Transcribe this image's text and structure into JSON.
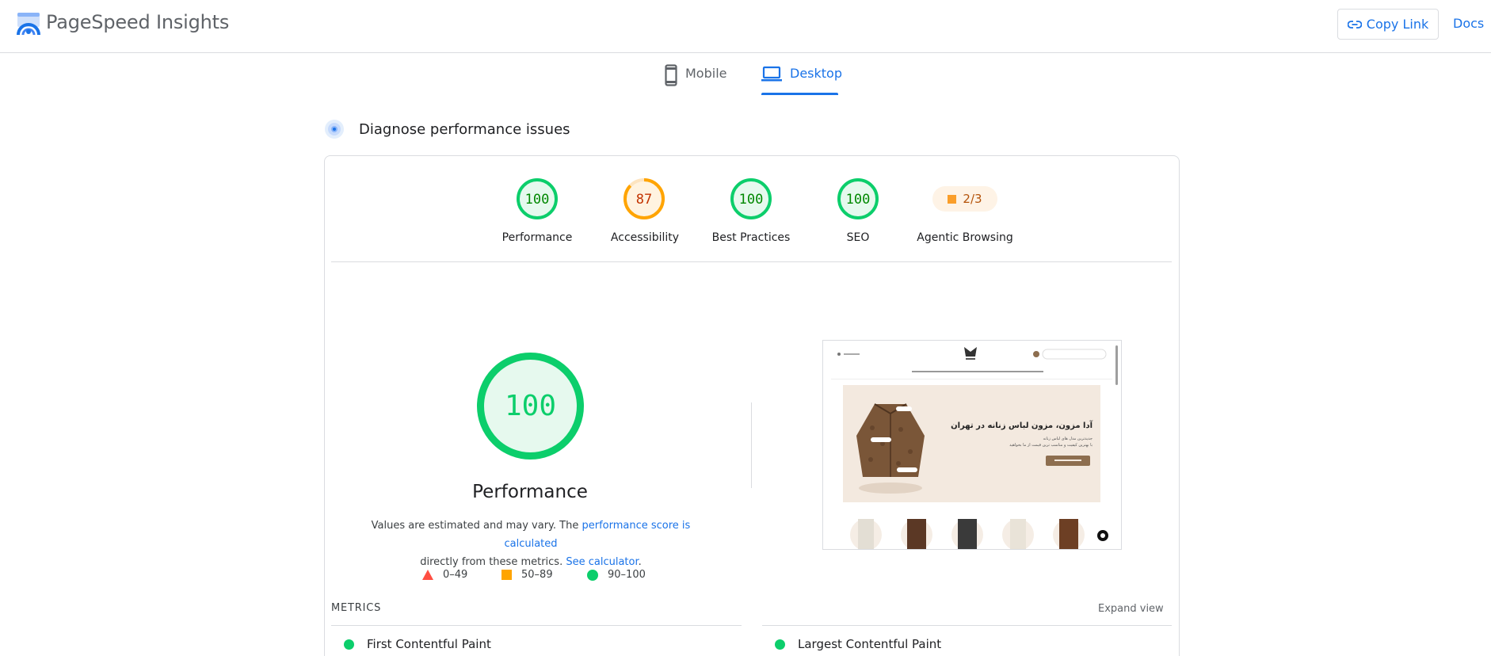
{
  "header": {
    "brand": "PageSpeed Insights",
    "copy_link_label": "Copy Link",
    "docs_label": "Docs",
    "logo_icon": "pagespeed-logo-icon",
    "link_icon": "link-icon"
  },
  "tabs": [
    {
      "label": "Mobile",
      "icon": "mobile-phone-icon",
      "active": false
    },
    {
      "label": "Desktop",
      "icon": "laptop-icon",
      "active": true
    }
  ],
  "diagnose": {
    "title": "Diagnose performance issues",
    "icon": "lighthouse-icon"
  },
  "categories": [
    {
      "label": "Performance",
      "score": "100",
      "status": "pass"
    },
    {
      "label": "Accessibility",
      "score": "87",
      "status": "average"
    },
    {
      "label": "Best Practices",
      "score": "100",
      "status": "pass"
    },
    {
      "label": "SEO",
      "score": "100",
      "status": "pass"
    },
    {
      "label": "Agentic Browsing",
      "score": "2/3",
      "status": "average"
    }
  ],
  "performance": {
    "score": "100",
    "title": "Performance",
    "desc_prefix": "Values are estimated and may vary. The ",
    "desc_link1": "performance score is calculated",
    "desc_middle": "directly from these metrics. ",
    "desc_link2": "See calculator",
    "desc_suffix": "."
  },
  "legend": [
    {
      "range": "0–49",
      "shape": "triangle",
      "color": "#ff4e42"
    },
    {
      "range": "50–89",
      "shape": "square",
      "color": "#ffa400"
    },
    {
      "range": "90–100",
      "shape": "circle",
      "color": "#0cce6b"
    }
  ],
  "metrics": {
    "heading": "METRICS",
    "expand_label": "Expand view",
    "items": [
      {
        "label": "First Contentful Paint",
        "status": "pass"
      },
      {
        "label": "Largest Contentful Paint",
        "status": "pass"
      }
    ]
  },
  "screenshot": {
    "hero_title": "آدا مزون، مزون لباس زنانه در تهران",
    "hero_sub1": "جدیدترین مدل های لباس زنانه",
    "hero_sub2": "با بهترین کیفیت و مناسب ترین قیمت از ما بخواهید"
  },
  "colors": {
    "pass": "#0cce6b",
    "pass_text": "#008800",
    "pass_fill": "#e6f9ee",
    "average": "#ffa400",
    "average_text": "#c33300",
    "average_fill": "#fff3e0",
    "link": "#1a73e8"
  }
}
